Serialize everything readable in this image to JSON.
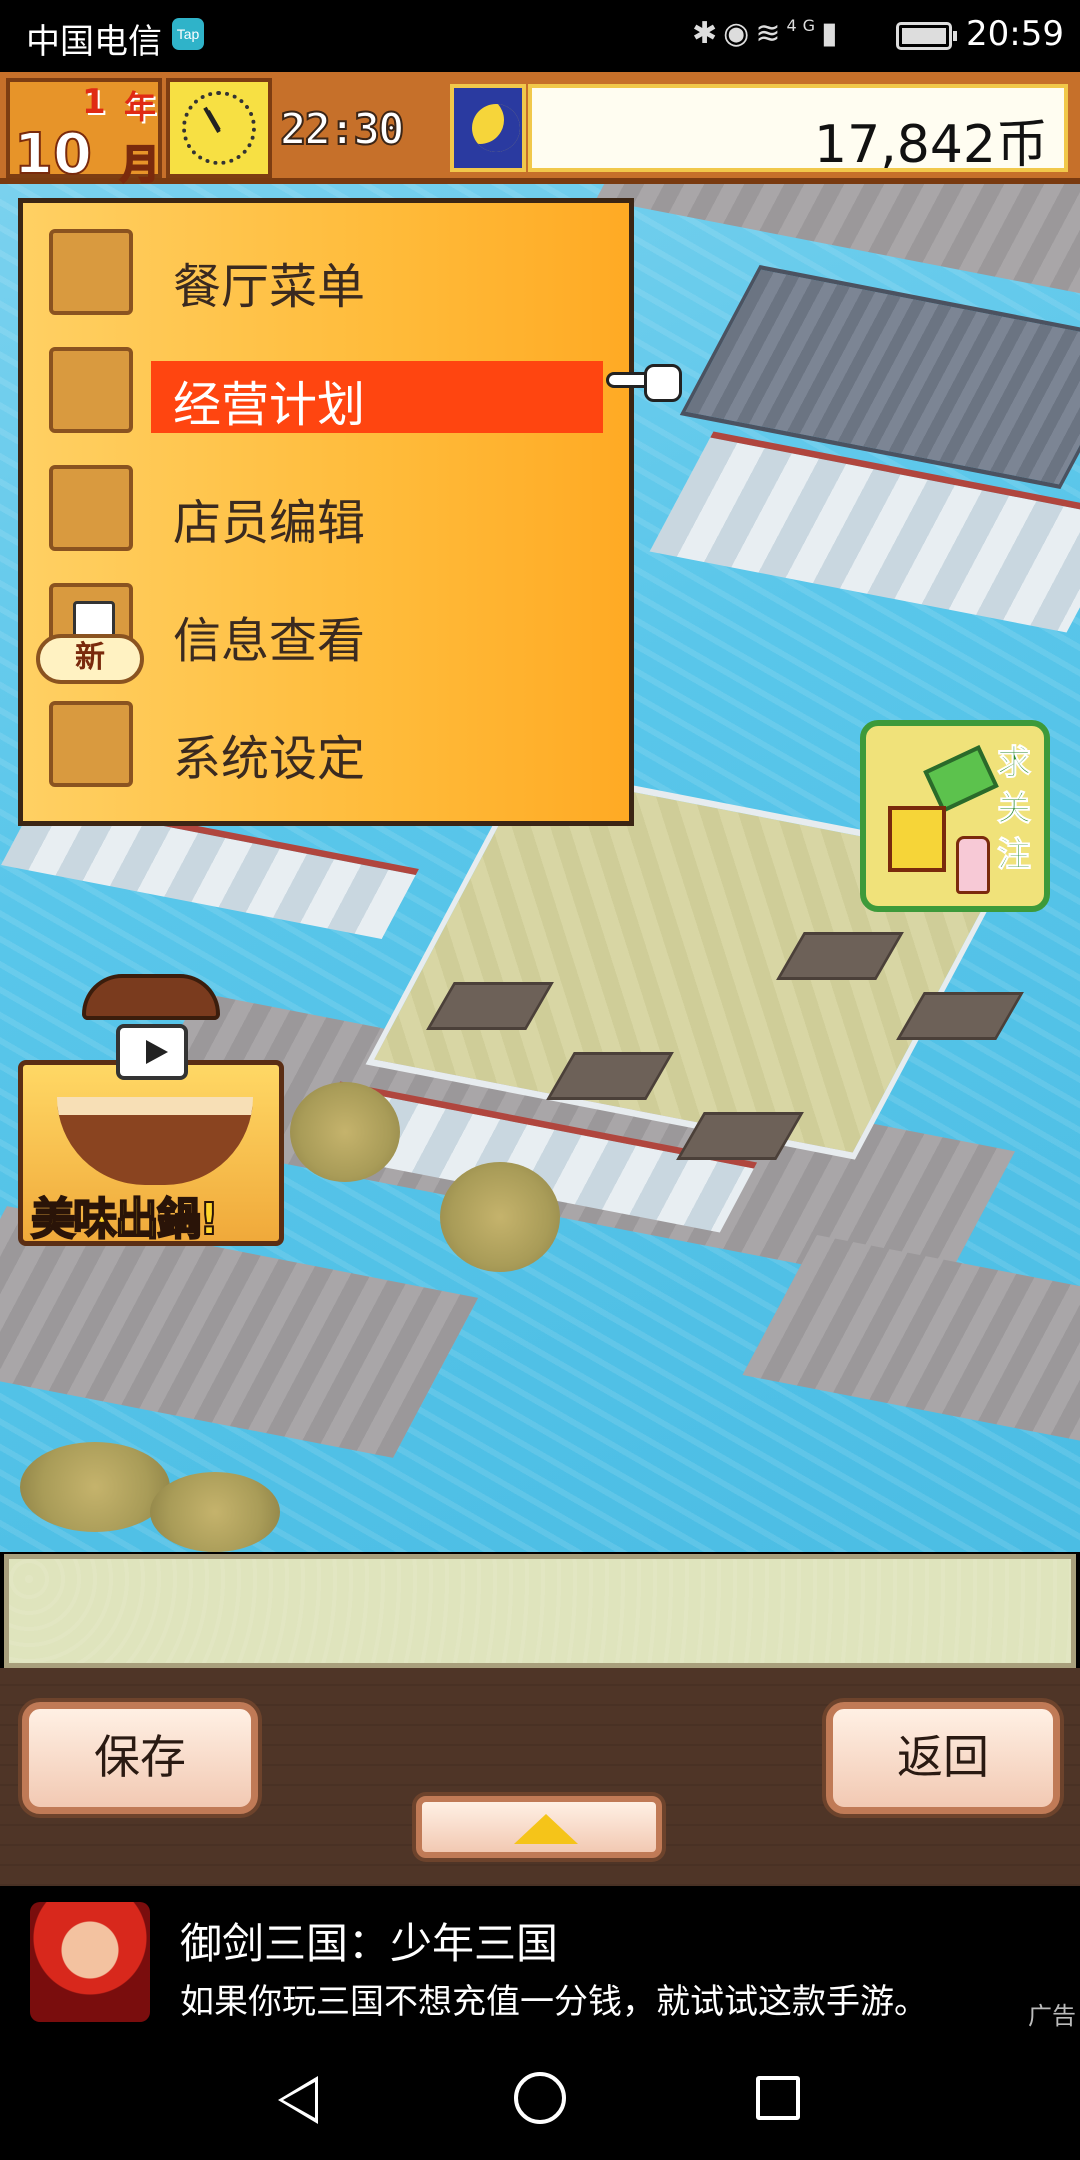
{
  "status_bar": {
    "carrier": "中国电信",
    "tap_badge": "Tap",
    "network_label": "4G",
    "time": "20:59"
  },
  "hud": {
    "year_number": "1",
    "year_label": "年",
    "month_number": "10",
    "month_label": "月",
    "game_time": "22:30",
    "money": "17,842币"
  },
  "menu": {
    "items": [
      {
        "label": "餐厅菜单",
        "icon": "dish-icon"
      },
      {
        "label": "经营计划",
        "icon": "shop-icon"
      },
      {
        "label": "店员编辑",
        "icon": "chef-icon"
      },
      {
        "label": "信息查看",
        "icon": "phone-icon"
      },
      {
        "label": "系统设定",
        "icon": "device-icon"
      }
    ],
    "selected_index": 1,
    "new_badge": "新"
  },
  "follow_badge": {
    "text": "求关注"
  },
  "hotpot_ad": {
    "label": "美味出鍋!"
  },
  "bottom_bar": {
    "save_label": "保存",
    "back_label": "返回"
  },
  "ad_banner": {
    "title": "御剑三国：少年三国",
    "description": "如果你玩三国不想充值一分钱，就试试这款手游。",
    "tag": "广告"
  },
  "colors": {
    "menu_highlight": "#ff4510",
    "hud_background": "#c6702a",
    "menu_background": "#ffbb3a",
    "bottom_bar": "#4f3527"
  }
}
